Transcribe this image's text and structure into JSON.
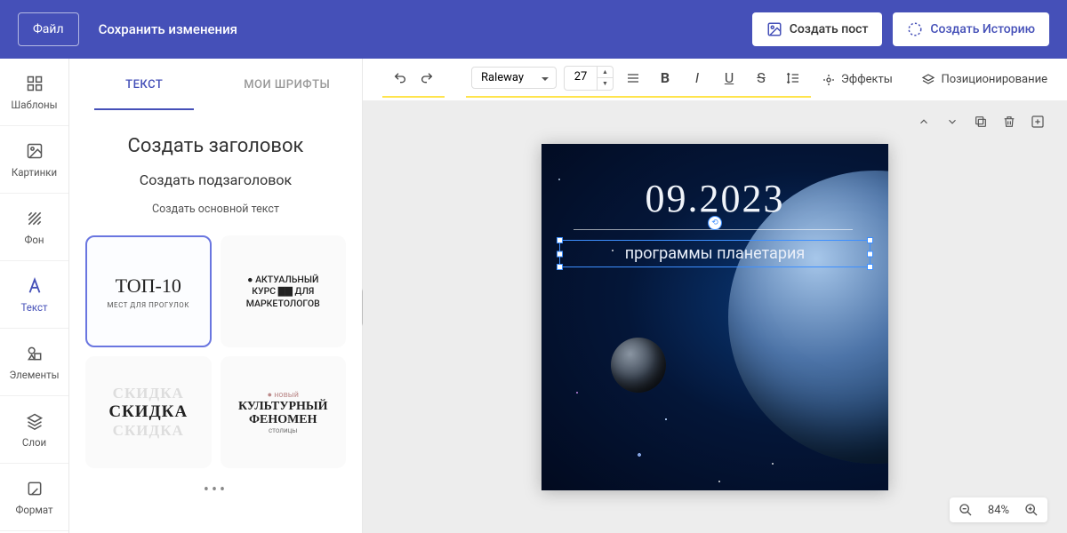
{
  "topbar": {
    "file": "Файл",
    "save": "Сохранить изменения",
    "create_post": "Создать пост",
    "create_story": "Создать Историю"
  },
  "sidebar": {
    "templates": "Шаблоны",
    "images": "Картинки",
    "background": "Фон",
    "text": "Текст",
    "elements": "Элементы",
    "layers": "Слои",
    "format": "Формат"
  },
  "panel": {
    "tab_text": "ТЕКСТ",
    "tab_fonts": "МОИ ШРИФТЫ",
    "opt_heading": "Создать заголовок",
    "opt_sub": "Создать подзаголовок",
    "opt_body": "Создать основной текст",
    "cards": {
      "c1_title": "ТОП-10",
      "c1_sub": "МЕСТ ДЛЯ ПРОГУЛОК",
      "c2_l1": "● АКТУАЛЬНЫЙ",
      "c2_l2": "КУРС ▇▇ ДЛЯ",
      "c2_l3": "МАРКЕТОЛОГОВ",
      "c3_ghost": "СКИДКА",
      "c3_main": "СКИДКА",
      "c4_new": "● новый",
      "c4_t1": "КУЛЬТУРНЫЙ",
      "c4_t2": "ФЕНОМЕН",
      "c4_sub": "столицы"
    }
  },
  "toolbar": {
    "font": "Raleway",
    "size": "27",
    "effects": "Эффекты",
    "positioning": "Позиционирование"
  },
  "canvas": {
    "date": "09.2023",
    "subtitle": "программы планетария",
    "zoom": "84%"
  }
}
